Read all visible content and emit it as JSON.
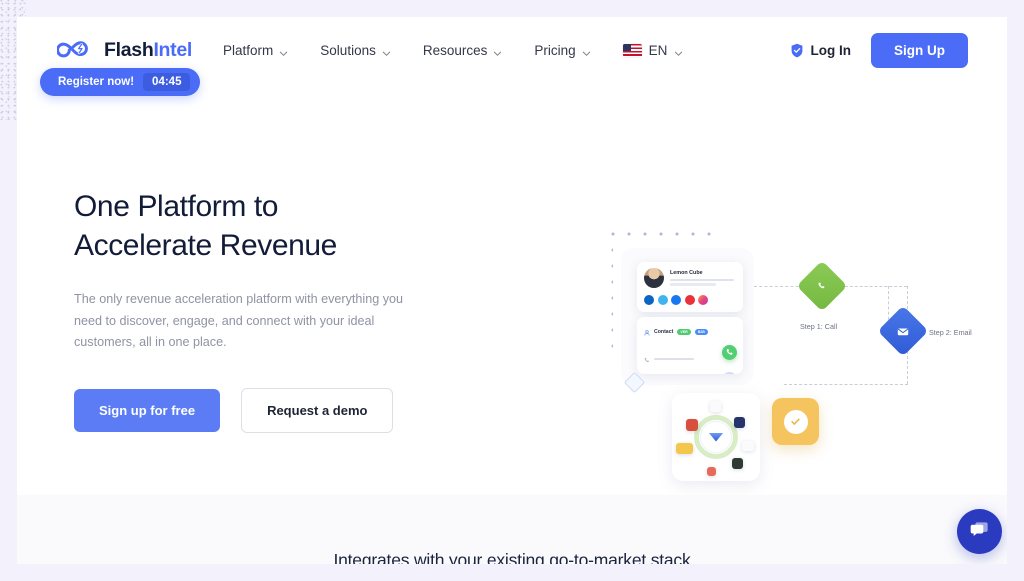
{
  "brand": {
    "name_part1": "Flash",
    "name_part2": "Intel",
    "icon": "infinity-bolt-logo"
  },
  "nav": {
    "items": [
      {
        "label": "Platform",
        "icon": "chevron-down-icon"
      },
      {
        "label": "Solutions",
        "icon": "chevron-down-icon"
      },
      {
        "label": "Resources",
        "icon": "chevron-down-icon"
      },
      {
        "label": "Pricing",
        "icon": "chevron-down-icon"
      }
    ],
    "language": {
      "label": "EN",
      "flag": "us-flag-icon",
      "icon": "chevron-down-icon"
    }
  },
  "header_actions": {
    "login_label": "Log In",
    "login_icon": "shield-icon",
    "signup_label": "Sign Up"
  },
  "hero": {
    "heading_line1": "One Platform to",
    "heading_line2": "Accelerate Revenue",
    "subtitle": "The only revenue acceleration platform with everything you need to discover, engage, and connect with your ideal customers, all in one place.",
    "primary_cta": "Sign up for free",
    "secondary_cta": "Request a demo"
  },
  "illustration": {
    "contact_name": "Lemon Cube",
    "contact_section_label": "Contact",
    "badge_verified": "VER",
    "badge_direct": "B2B",
    "social_icons": [
      "linkedin-icon",
      "twitter-icon",
      "facebook-icon",
      "youtube-icon",
      "instagram-icon"
    ],
    "step1_label": "Step 1: Call",
    "step1_icon": "phone-icon",
    "step2_label": "Step 2: Email",
    "step2_icon": "envelope-icon",
    "success_icon": "check-circle-icon",
    "hub_icon": "integrations-hub-icon"
  },
  "footer": {
    "register_label": "Register now!",
    "timer": "04:45",
    "band_title": "Integrates with your existing go-to-market stack",
    "chat_icon": "chat-bubble-icon"
  },
  "colors": {
    "brand_blue": "#4a6cf7",
    "heading_navy": "#121b37",
    "muted_text": "#8f93a3",
    "green": "#74b842",
    "amber": "#f5c45e",
    "chat_blue": "#2b3bbf"
  }
}
